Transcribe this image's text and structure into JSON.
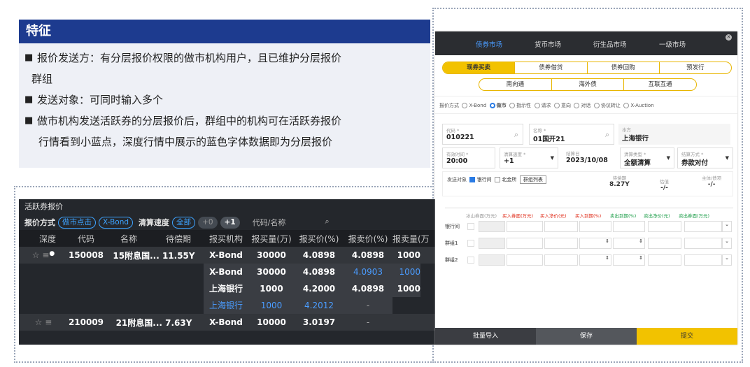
{
  "feature": {
    "title": "特征",
    "bullets": [
      {
        "line1": "报价发送方：有分层报价权限的做市机构用户，且已维护分层报价",
        "line2": "群组"
      },
      {
        "line1": "发送对象：可同时输入多个",
        "line2": ""
      },
      {
        "line1": "做市机构发送活跃券的分层报价后，群组中的机构可在活跃券报价",
        "line2": "行情看到小蓝点，深度行情中展示的蓝色字体数据即为分层报价"
      }
    ],
    "bullet_mark": "■"
  },
  "table": {
    "title": "活跃券报价",
    "quote_method_label": "报价方式",
    "pill_mm": "做市点击",
    "pill_xbond": "X-Bond",
    "speed_label": "清算速度",
    "pill_all": "全部",
    "pill_t0": "+0",
    "pill_t1": "+1",
    "search_placeholder": "代码/名称",
    "headers": [
      "深度",
      "代码",
      "名称",
      "待偿期",
      "报买机构",
      "报买量(万)",
      "报买价(%)",
      "报卖价(%)",
      "报卖量(万"
    ],
    "rows": [
      {
        "code": "150008",
        "name": "15附息国... 11.55Y",
        "inst": "X-Bond",
        "bvol": "30000",
        "bid": "4.0898",
        "ask": "4.0898",
        "avol": "1000"
      },
      {
        "code": "",
        "name": "",
        "inst": "X-Bond",
        "bvol": "30000",
        "bid": "4.0898",
        "ask": "4.0903",
        "avol": "1000"
      },
      {
        "code": "",
        "name": "",
        "inst": "上海银行",
        "bvol": "1000",
        "bid": "4.2000",
        "ask": "4.0898",
        "avol": "1000"
      },
      {
        "code": "",
        "name": "",
        "inst": "上海银行",
        "bvol": "1000",
        "bid": "4.2012",
        "ask": "-",
        "avol": ""
      },
      {
        "code": "210009",
        "name": "21附息国... 7.63Y",
        "inst": "X-Bond",
        "bvol": "10000",
        "bid": "3.0197",
        "ask": "-",
        "avol": ""
      }
    ]
  },
  "modal": {
    "tabs": [
      "债券市场",
      "货币市场",
      "衍生品市场",
      "一级市场"
    ],
    "seg1": [
      "现券买卖",
      "债券借贷",
      "债券回购",
      "预发行"
    ],
    "seg2": [
      "南向通",
      "海外债",
      "互联互通"
    ],
    "method_label": "报价方式",
    "methods": [
      "X-Bond",
      "做市",
      "指示性",
      "请求",
      "意向",
      "对话",
      "协议转让",
      "X-Auction"
    ],
    "code_label": "代码 *",
    "code_value": "010221",
    "name_label": "名称 *",
    "name_value": "01国开21",
    "party_label": "本方",
    "party_value": "上海银行",
    "time_label": "有效时间 *",
    "time_value": "20:00",
    "speed_label": "清算速度 *",
    "speed_value": "+1",
    "settle_date_label": "结算日",
    "settle_date_value": "2023/10/08",
    "settle_type_label": "清算类型 *",
    "settle_type_value": "全额清算",
    "settle_mode_label": "结算方式 *",
    "settle_mode_value": "券款对付",
    "send_label": "发送对象",
    "interbank": "银行间",
    "bse": "北金所",
    "group_list": "群组列表",
    "maturity_label": "待偿期",
    "maturity_value": "8.27Y",
    "valuation_label": "估值",
    "valuation_value": "-/-",
    "rating_label": "主体/债项",
    "rating_value": "-/-",
    "grid_headers": [
      "冰山券面(万元)",
      "买入券面(万元)",
      "买入净价(元)",
      "买入到期(%)",
      "卖出到期(%)",
      "卖出净价(元)",
      "卖出券面(万元)"
    ],
    "grid_rows": [
      "银行间",
      "群组1",
      "群组2"
    ],
    "btn_import": "批量导入",
    "btn_save": "保存",
    "btn_submit": "提交"
  }
}
